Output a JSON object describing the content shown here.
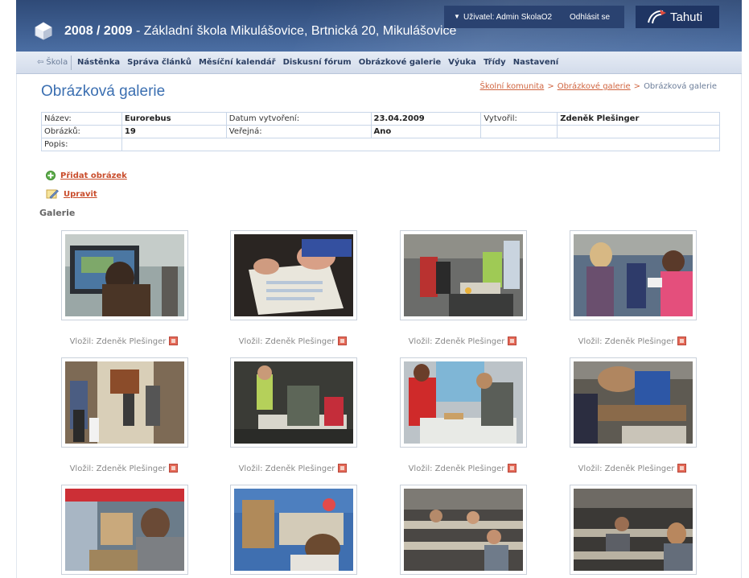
{
  "header": {
    "title_year": "2008 / 2009",
    "title_school": " - Základní škola Mikulášovice, Brtnická 20, Mikulášovice",
    "user_label": "Uživatel: Admin SkolaO2",
    "logout_label": "Odhlásit se",
    "brand_name": "Tahuti"
  },
  "nav": {
    "home_label": "Škola",
    "items": [
      "Nástěnka",
      "Správa článků",
      "Měsíční kalendář",
      "Diskusní fórum",
      "Obrázkové galerie",
      "Výuka",
      "Třídy",
      "Nastavení"
    ]
  },
  "page": {
    "title": "Obrázková galerie",
    "breadcrumb": [
      "Školní komunita",
      "Obrázkové galerie",
      "Obrázková galerie"
    ],
    "breadcrumb_sep": ">"
  },
  "info": {
    "name_label": "Název:",
    "name_value": "Eurorebus",
    "created_label": "Datum vytvoření:",
    "created_value": "23.04.2009",
    "author_label": "Vytvořil:",
    "author_value": "Zdeněk Plešinger",
    "count_label": "Obrázků:",
    "count_value": "19",
    "public_label": "Veřejná:",
    "public_value": "Ano",
    "desc_label": "Popis:"
  },
  "actions": {
    "add_label": "Přidat obrázek",
    "edit_label": "Upravit"
  },
  "gallery": {
    "heading": "Galerie",
    "caption": "Vložil: Zdeněk Plešinger"
  },
  "colors": {
    "header_bg": "#3d5d8f",
    "accent_link": "#d0643f",
    "title_blue": "#3b6fb1"
  }
}
